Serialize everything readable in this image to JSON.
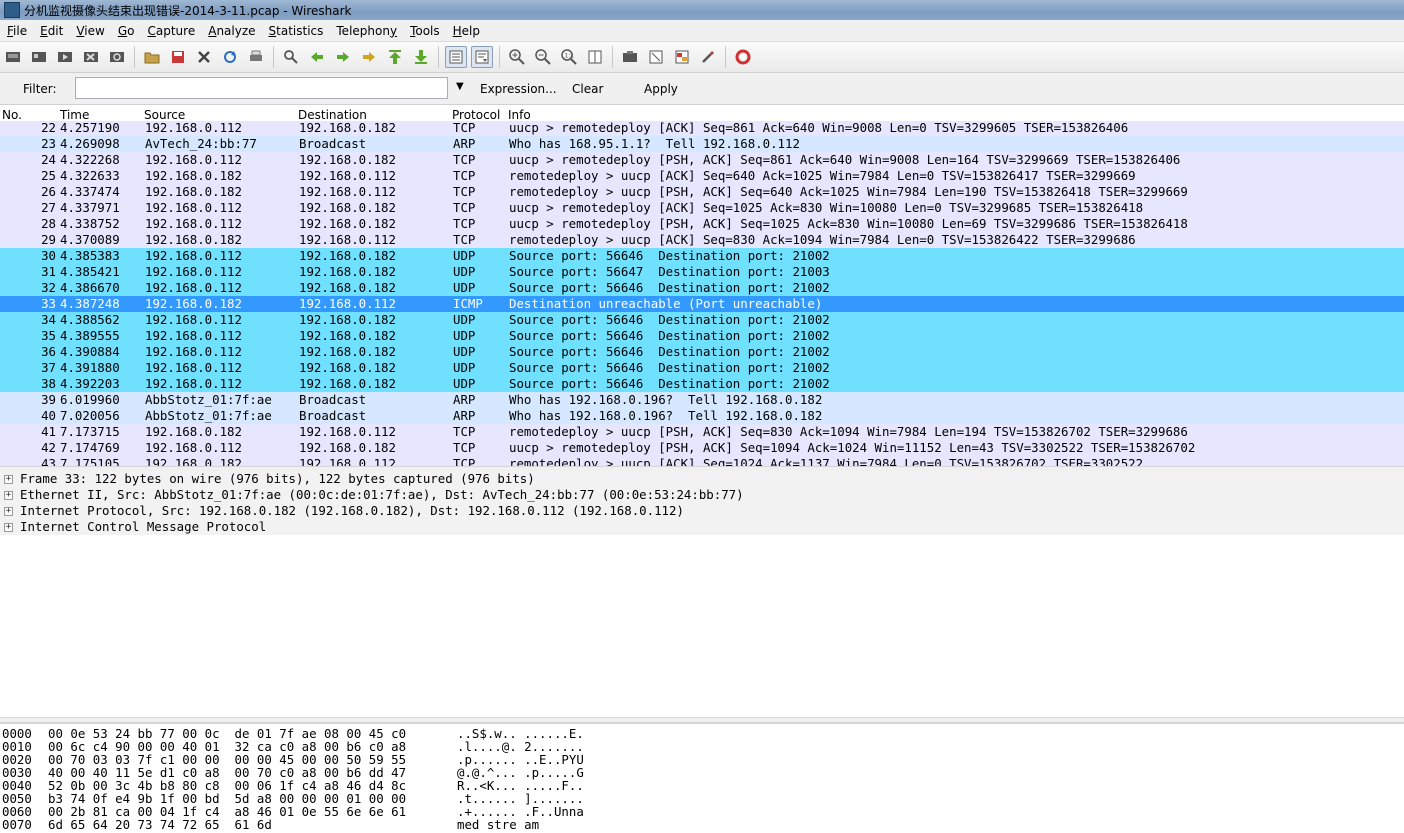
{
  "window": {
    "title": "分机监视摄像头结束出现错误-2014-3-11.pcap - Wireshark"
  },
  "menu": [
    {
      "pre": "",
      "acc": "F",
      "post": "ile"
    },
    {
      "pre": "",
      "acc": "E",
      "post": "dit"
    },
    {
      "pre": "",
      "acc": "V",
      "post": "iew"
    },
    {
      "pre": "",
      "acc": "G",
      "post": "o"
    },
    {
      "pre": "",
      "acc": "C",
      "post": "apture"
    },
    {
      "pre": "",
      "acc": "A",
      "post": "nalyze"
    },
    {
      "pre": "",
      "acc": "S",
      "post": "tatistics"
    },
    {
      "pre": "Telephon",
      "acc": "y",
      "post": ""
    },
    {
      "pre": "",
      "acc": "T",
      "post": "ools"
    },
    {
      "pre": "",
      "acc": "H",
      "post": "elp"
    }
  ],
  "filter": {
    "label": "Filter:",
    "value": "",
    "expression": "Expression...",
    "clear": "Clear",
    "apply": "Apply"
  },
  "columns": {
    "no": "No.",
    "time": "Time",
    "source": "Source",
    "destination": "Destination",
    "protocol": "Protocol",
    "info": "Info"
  },
  "packets": [
    {
      "no": "22",
      "time": "4.257190",
      "src": "192.168.0.112",
      "dst": "192.168.0.182",
      "proto": "TCP",
      "info": "uucp > remotedeploy [ACK] Seq=861 Ack=640 Win=9008 Len=0 TSV=3299605 TSER=153826406",
      "bg": "#e7e6ff"
    },
    {
      "no": "23",
      "time": "4.269098",
      "src": "AvTech_24:bb:77",
      "dst": "Broadcast",
      "proto": "ARP",
      "info": "Who has 168.95.1.1?  Tell 192.168.0.112",
      "bg": "#d6e8ff"
    },
    {
      "no": "24",
      "time": "4.322268",
      "src": "192.168.0.112",
      "dst": "192.168.0.182",
      "proto": "TCP",
      "info": "uucp > remotedeploy [PSH, ACK] Seq=861 Ack=640 Win=9008 Len=164 TSV=3299669 TSER=153826406",
      "bg": "#e7e6ff"
    },
    {
      "no": "25",
      "time": "4.322633",
      "src": "192.168.0.182",
      "dst": "192.168.0.112",
      "proto": "TCP",
      "info": "remotedeploy > uucp [ACK] Seq=640 Ack=1025 Win=7984 Len=0 TSV=153826417 TSER=3299669",
      "bg": "#e7e6ff"
    },
    {
      "no": "26",
      "time": "4.337474",
      "src": "192.168.0.182",
      "dst": "192.168.0.112",
      "proto": "TCP",
      "info": "remotedeploy > uucp [PSH, ACK] Seq=640 Ack=1025 Win=7984 Len=190 TSV=153826418 TSER=3299669",
      "bg": "#e7e6ff"
    },
    {
      "no": "27",
      "time": "4.337971",
      "src": "192.168.0.112",
      "dst": "192.168.0.182",
      "proto": "TCP",
      "info": "uucp > remotedeploy [ACK] Seq=1025 Ack=830 Win=10080 Len=0 TSV=3299685 TSER=153826418",
      "bg": "#e7e6ff"
    },
    {
      "no": "28",
      "time": "4.338752",
      "src": "192.168.0.112",
      "dst": "192.168.0.182",
      "proto": "TCP",
      "info": "uucp > remotedeploy [PSH, ACK] Seq=1025 Ack=830 Win=10080 Len=69 TSV=3299686 TSER=153826418",
      "bg": "#e7e6ff"
    },
    {
      "no": "29",
      "time": "4.370089",
      "src": "192.168.0.182",
      "dst": "192.168.0.112",
      "proto": "TCP",
      "info": "remotedeploy > uucp [ACK] Seq=830 Ack=1094 Win=7984 Len=0 TSV=153826422 TSER=3299686",
      "bg": "#e7e6ff"
    },
    {
      "no": "30",
      "time": "4.385383",
      "src": "192.168.0.112",
      "dst": "192.168.0.182",
      "proto": "UDP",
      "info": "Source port: 56646  Destination port: 21002",
      "bg": "#70e0ff"
    },
    {
      "no": "31",
      "time": "4.385421",
      "src": "192.168.0.112",
      "dst": "192.168.0.182",
      "proto": "UDP",
      "info": "Source port: 56647  Destination port: 21003",
      "bg": "#70e0ff"
    },
    {
      "no": "32",
      "time": "4.386670",
      "src": "192.168.0.112",
      "dst": "192.168.0.182",
      "proto": "UDP",
      "info": "Source port: 56646  Destination port: 21002",
      "bg": "#70e0ff"
    },
    {
      "no": "33",
      "time": "4.387248",
      "src": "192.168.0.182",
      "dst": "192.168.0.112",
      "proto": "ICMP",
      "info": "Destination unreachable (Port unreachable)",
      "bg": "#3399ff",
      "fg": "#ffffff",
      "selected": true
    },
    {
      "no": "34",
      "time": "4.388562",
      "src": "192.168.0.112",
      "dst": "192.168.0.182",
      "proto": "UDP",
      "info": "Source port: 56646  Destination port: 21002",
      "bg": "#70e0ff"
    },
    {
      "no": "35",
      "time": "4.389555",
      "src": "192.168.0.112",
      "dst": "192.168.0.182",
      "proto": "UDP",
      "info": "Source port: 56646  Destination port: 21002",
      "bg": "#70e0ff"
    },
    {
      "no": "36",
      "time": "4.390884",
      "src": "192.168.0.112",
      "dst": "192.168.0.182",
      "proto": "UDP",
      "info": "Source port: 56646  Destination port: 21002",
      "bg": "#70e0ff"
    },
    {
      "no": "37",
      "time": "4.391880",
      "src": "192.168.0.112",
      "dst": "192.168.0.182",
      "proto": "UDP",
      "info": "Source port: 56646  Destination port: 21002",
      "bg": "#70e0ff"
    },
    {
      "no": "38",
      "time": "4.392203",
      "src": "192.168.0.112",
      "dst": "192.168.0.182",
      "proto": "UDP",
      "info": "Source port: 56646  Destination port: 21002",
      "bg": "#70e0ff"
    },
    {
      "no": "39",
      "time": "6.019960",
      "src": "AbbStotz_01:7f:ae",
      "dst": "Broadcast",
      "proto": "ARP",
      "info": "Who has 192.168.0.196?  Tell 192.168.0.182",
      "bg": "#d6e8ff"
    },
    {
      "no": "40",
      "time": "7.020056",
      "src": "AbbStotz_01:7f:ae",
      "dst": "Broadcast",
      "proto": "ARP",
      "info": "Who has 192.168.0.196?  Tell 192.168.0.182",
      "bg": "#d6e8ff"
    },
    {
      "no": "41",
      "time": "7.173715",
      "src": "192.168.0.182",
      "dst": "192.168.0.112",
      "proto": "TCP",
      "info": "remotedeploy > uucp [PSH, ACK] Seq=830 Ack=1094 Win=7984 Len=194 TSV=153826702 TSER=3299686",
      "bg": "#e7e6ff"
    },
    {
      "no": "42",
      "time": "7.174769",
      "src": "192.168.0.112",
      "dst": "192.168.0.182",
      "proto": "TCP",
      "info": "uucp > remotedeploy [PSH, ACK] Seq=1094 Ack=1024 Win=11152 Len=43 TSV=3302522 TSER=153826702",
      "bg": "#e7e6ff"
    },
    {
      "no": "43",
      "time": "7.175105",
      "src": "192.168.0.182",
      "dst": "192.168.0.112",
      "proto": "TCP",
      "info": "remotedeploy > uucp [ACK] Seq=1024 Ack=1137 Win=7984 Len=0 TSV=153826702 TSER=3302522",
      "bg": "#e7e6ff"
    }
  ],
  "details": [
    "Frame 33: 122 bytes on wire (976 bits), 122 bytes captured (976 bits)",
    "Ethernet II, Src: AbbStotz_01:7f:ae (00:0c:de:01:7f:ae), Dst: AvTech_24:bb:77 (00:0e:53:24:bb:77)",
    "Internet Protocol, Src: 192.168.0.182 (192.168.0.182), Dst: 192.168.0.112 (192.168.0.112)",
    "Internet Control Message Protocol"
  ],
  "hexdump": [
    {
      "off": "0000",
      "hex": "00 0e 53 24 bb 77 00 0c  de 01 7f ae 08 00 45 c0",
      "ascii": "..S$.w.. ......E."
    },
    {
      "off": "0010",
      "hex": "00 6c c4 90 00 00 40 01  32 ca c0 a8 00 b6 c0 a8",
      "ascii": ".l....@. 2......."
    },
    {
      "off": "0020",
      "hex": "00 70 03 03 7f c1 00 00  00 00 45 00 00 50 59 55",
      "ascii": ".p...... ..E..PYU"
    },
    {
      "off": "0030",
      "hex": "40 00 40 11 5e d1 c0 a8  00 70 c0 a8 00 b6 dd 47",
      "ascii": "@.@.^... .p.....G"
    },
    {
      "off": "0040",
      "hex": "52 0b 00 3c 4b b8 80 c8  00 06 1f c4 a8 46 d4 8c",
      "ascii": "R..<K... .....F.."
    },
    {
      "off": "0050",
      "hex": "b3 74 0f e4 9b 1f 00 bd  5d a8 00 00 00 01 00 00",
      "ascii": ".t...... ]......."
    },
    {
      "off": "0060",
      "hex": "00 2b 81 ca 00 04 1f c4  a8 46 01 0e 55 6e 6e 61",
      "ascii": ".+...... .F..Unna"
    },
    {
      "off": "0070",
      "hex": "6d 65 64 20 73 74 72 65  61 6d",
      "ascii": "med stre am"
    }
  ]
}
